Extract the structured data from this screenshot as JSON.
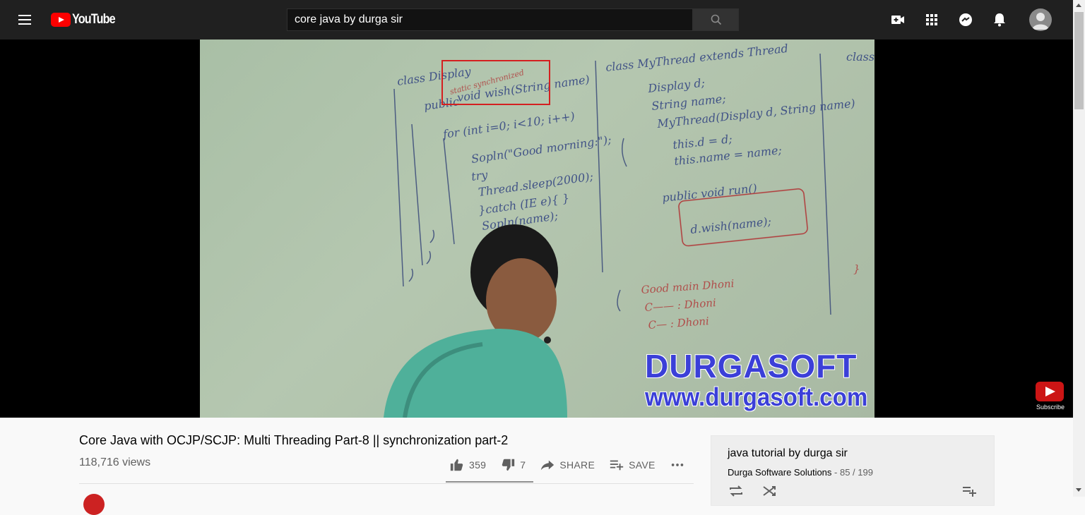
{
  "header": {
    "logo_text": "YouTube",
    "search_value": "core java by durga sir"
  },
  "icons": {
    "menu": "hamburger-menu-icon",
    "search": "search-icon",
    "create": "video-camera-icon",
    "apps": "apps-grid-icon",
    "messages": "messages-icon",
    "notifications": "bell-icon",
    "account": "account-icon"
  },
  "video": {
    "watermark_name": "DURGASOFT",
    "watermark_url": "www.durgasoft.com",
    "subscribe_label": "Subscribe"
  },
  "info": {
    "title": "Core Java with OCJP/SCJP: Multi Threading Part-8 || synchronization part-2",
    "views": "118,716 views",
    "like_count": "359",
    "dislike_count": "7",
    "share_label": "SHARE",
    "save_label": "SAVE",
    "like_ratio": 0.98
  },
  "playlist": {
    "title": "java tutorial by durga sir",
    "channel": "Durga Software Solutions",
    "separator": " - ",
    "position": "85 / 199"
  },
  "colors": {
    "header_bg": "#202020",
    "brand_red": "#ff0000",
    "watermark_blue": "#3b3fd8",
    "highlight_box": "#d42020"
  }
}
